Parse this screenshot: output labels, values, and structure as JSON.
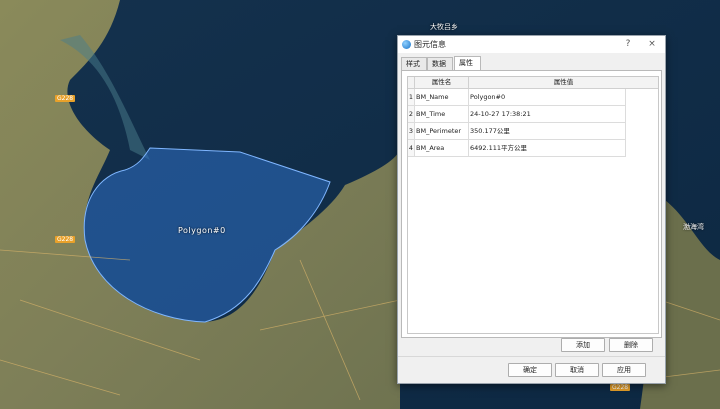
{
  "map": {
    "polygon_label": "Polygon#0",
    "place_labels": [
      "大牧吕乡",
      "渤海湾"
    ],
    "road_badges": [
      "G228",
      "G228",
      "G228"
    ]
  },
  "dialog": {
    "title": "图元信息",
    "help_icon": "?",
    "close_icon": "×",
    "tabs": [
      "样式",
      "数据",
      "属性"
    ],
    "active_tab": "属性",
    "grid": {
      "headers": [
        "属性名",
        "属性值"
      ],
      "rows": [
        {
          "index": "1",
          "name": "BM_Name",
          "value": "Polygon#0"
        },
        {
          "index": "2",
          "name": "BM_Time",
          "value": "24-10-27 17:38:21"
        },
        {
          "index": "3",
          "name": "BM_Perimeter",
          "value": "350.177公里"
        },
        {
          "index": "4",
          "name": "BM_Area",
          "value": "6492.111平方公里"
        }
      ]
    },
    "add_label": "添加",
    "delete_label": "删除",
    "ok_label": "确定",
    "cancel_label": "取消",
    "apply_label": "应用"
  }
}
